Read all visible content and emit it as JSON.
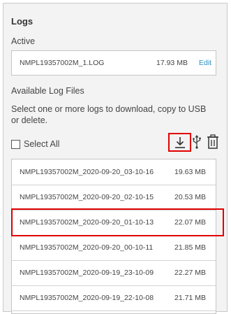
{
  "panel": {
    "title": "Logs",
    "active_label": "Active",
    "active_file": {
      "name": "NMPL19357002M_1.LOG",
      "size": "17.93 MB",
      "edit_label": "Edit"
    },
    "available_label": "Available Log Files",
    "description": "Select one or more logs to download, copy to USB or delete.",
    "select_all_label": "Select All",
    "icons": {
      "download": "download-icon",
      "usb": "usb-icon",
      "delete": "trash-icon"
    },
    "highlight_color": "#e00000",
    "link_color": "#2a8fc7"
  },
  "files": [
    {
      "name": "NMPL19357002M_2020-09-20_03-10-16",
      "size": "19.63 MB"
    },
    {
      "name": "NMPL19357002M_2020-09-20_02-10-15",
      "size": "20.53 MB"
    },
    {
      "name": "NMPL19357002M_2020-09-20_01-10-13",
      "size": "22.07 MB",
      "highlighted": true
    },
    {
      "name": "NMPL19357002M_2020-09-20_00-10-11",
      "size": "21.85 MB"
    },
    {
      "name": "NMPL19357002M_2020-09-19_23-10-09",
      "size": "22.27 MB"
    },
    {
      "name": "NMPL19357002M_2020-09-19_22-10-08",
      "size": "21.71 MB"
    }
  ]
}
